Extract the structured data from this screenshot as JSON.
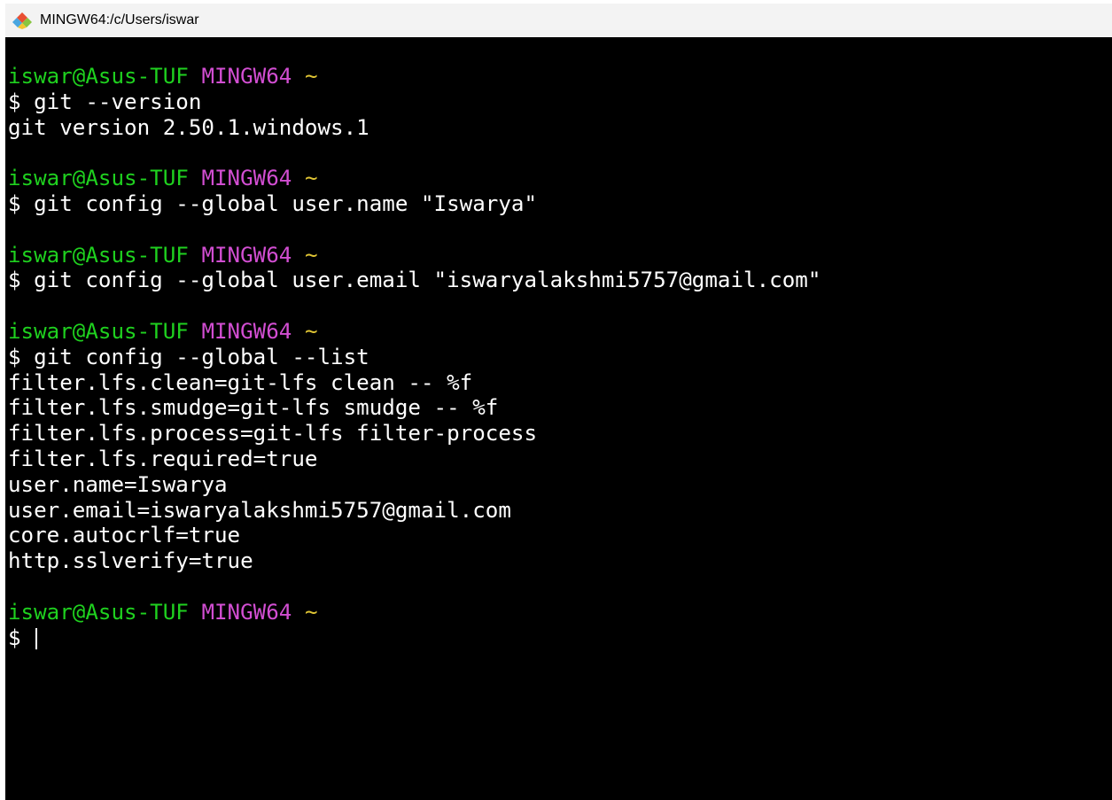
{
  "window": {
    "title": "MINGW64:/c/Users/iswar",
    "icon": "git-diamond-icon"
  },
  "colors": {
    "user_host": "#1fd11f",
    "system": "#d24ed2",
    "directory": "#e0c534",
    "text": "#ffffff",
    "background": "#000000"
  },
  "terminal": {
    "prompt_user_host": "iswar@Asus-TUF",
    "prompt_system": "MINGW64",
    "prompt_directory": "~",
    "prompt_symbol": "$",
    "blocks": [
      {
        "command": "git --version",
        "output": [
          "git version 2.50.1.windows.1"
        ]
      },
      {
        "command": "git config --global user.name \"Iswarya\"",
        "output": []
      },
      {
        "command": "git config --global user.email \"iswaryalakshmi5757@gmail.com\"",
        "output": []
      },
      {
        "command": "git config --global --list",
        "output": [
          "filter.lfs.clean=git-lfs clean -- %f",
          "filter.lfs.smudge=git-lfs smudge -- %f",
          "filter.lfs.process=git-lfs filter-process",
          "filter.lfs.required=true",
          "user.name=Iswarya",
          "user.email=iswaryalakshmi5757@gmail.com",
          "core.autocrlf=true",
          "http.sslverify=true"
        ]
      }
    ],
    "current_input": ""
  }
}
